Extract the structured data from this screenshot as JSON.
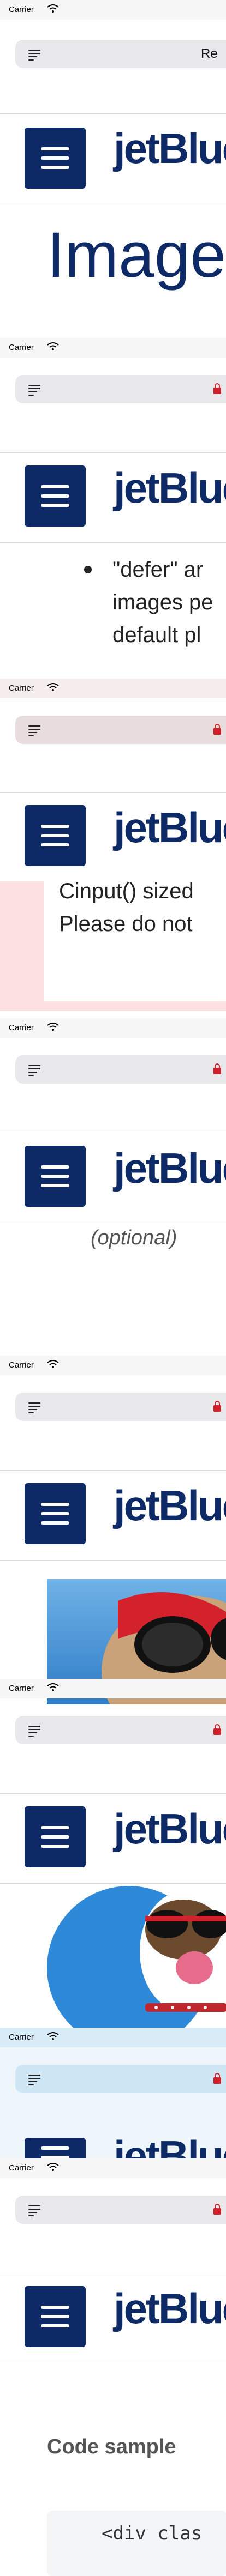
{
  "status": {
    "carrier": "Carrier"
  },
  "urlbar": {
    "text": "Re"
  },
  "brand": {
    "logo": "jetBlue"
  },
  "page": {
    "title": "Image",
    "frag_bullet_line1": "\"defer\" ar",
    "frag_bullet_line2": "images pe",
    "frag_bullet_line3": "default pl",
    "frag_pink_line1": "Cinput() sized",
    "frag_pink_line2": "Please do not",
    "frag_optional": "(optional)",
    "code_sample_title": "Code sample",
    "code_snippet": "<div clas"
  },
  "colors": {
    "brand": "#0d2a66",
    "pink": "#fde1e1",
    "gray": "#e9e9eb"
  },
  "icons": [
    "wifi-icon",
    "menu-icon",
    "lock-icon",
    "hamburger-icon"
  ]
}
